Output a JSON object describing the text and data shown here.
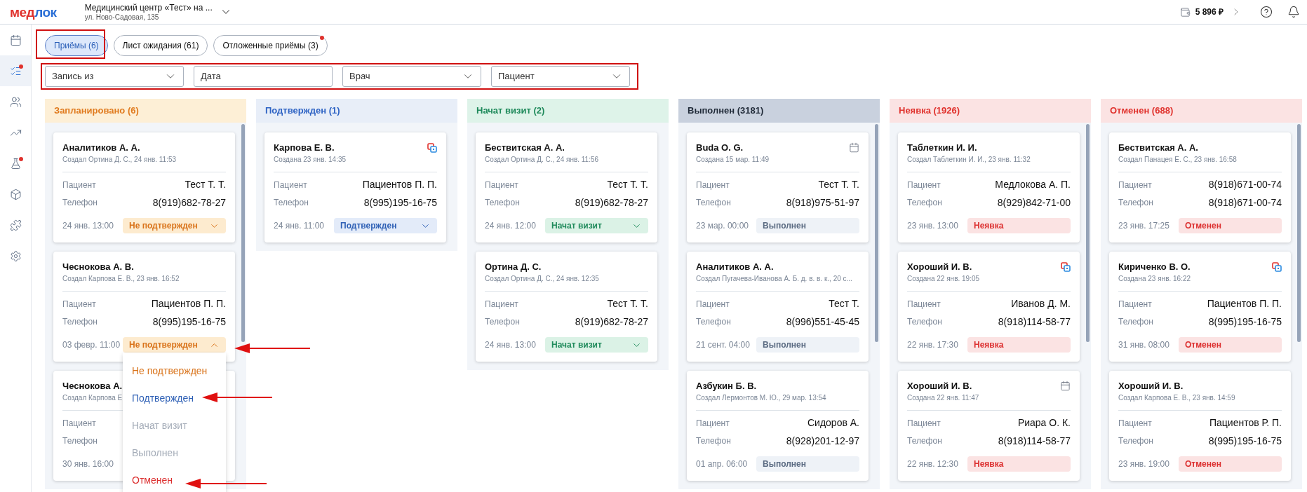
{
  "header": {
    "logo": {
      "primary": "мед",
      "secondary": "лок"
    },
    "clinic": {
      "name": "Медицинский центр «Тест» на ...",
      "address": "ул. Ново-Садовая, 135"
    },
    "balance": "5 896 ₽"
  },
  "sidebar": {
    "items": [
      {
        "selected": false,
        "badge": false
      },
      {
        "selected": true,
        "badge": true
      },
      {
        "selected": false,
        "badge": false
      },
      {
        "selected": false,
        "badge": false
      },
      {
        "selected": false,
        "badge": true
      },
      {
        "selected": false,
        "badge": false
      },
      {
        "selected": false,
        "badge": false
      },
      {
        "selected": false,
        "badge": false
      }
    ]
  },
  "tabs": [
    {
      "label": "Приёмы (6)",
      "selected": true,
      "badge": false
    },
    {
      "label": "Лист ожидания (61)",
      "selected": false,
      "badge": false
    },
    {
      "label": "Отложенные приёмы (3)",
      "selected": false,
      "badge": true
    }
  ],
  "filters": [
    {
      "kind": "select",
      "placeholder": "Запись из"
    },
    {
      "kind": "input",
      "placeholder": "Дата"
    },
    {
      "kind": "select",
      "placeholder": "Врач"
    },
    {
      "kind": "select",
      "placeholder": "Пациент"
    }
  ],
  "columns": [
    {
      "kind": "planned",
      "title": "Запланировано (6)",
      "cards": [
        {
          "name": "Аналитиков А. А.",
          "created": "Создал Ортина Д. С., 24 янв. 11:53",
          "patient_label": "Пациент",
          "patient": "Тест Т. Т.",
          "phone_label": "Телефон",
          "phone": "8(919)682-78-27",
          "date": "24 янв. 13:00",
          "status": {
            "kind": "planned",
            "label": "Не подтвержден",
            "expanded": false
          }
        },
        {
          "name": "Чеснокова А. В.",
          "created": "Создал Карпова Е. В., 23 янв. 16:52",
          "patient_label": "Пациент",
          "patient": "Пациентов П. П.",
          "phone_label": "Телефон",
          "phone": "8(995)195-16-75",
          "date": "03 февр. 11:00",
          "status": {
            "kind": "planned",
            "label": "Не подтвержден",
            "expanded": true,
            "menu": [
              {
                "kind": "planned",
                "label": "Не подтвержден",
                "disabled": false
              },
              {
                "kind": "confirmed",
                "label": "Подтвержден",
                "disabled": false
              },
              {
                "label": "Начат визит",
                "disabled": true
              },
              {
                "label": "Выполнен",
                "disabled": true
              },
              {
                "kind": "cancelled",
                "label": "Отменен",
                "disabled": false
              }
            ]
          }
        },
        {
          "name": "Чеснокова А.",
          "created": "Создал Карпова Е",
          "patient_label": "Пациент",
          "phone_label": "Телефон",
          "date": "30 янв. 16:00"
        }
      ]
    },
    {
      "kind": "confirmed",
      "title": "Подтвержден (1)",
      "cards": [
        {
          "name": "Карпова Е. В.",
          "kind": "online",
          "created": "Создана 23 янв. 14:35",
          "patient_label": "Пациент",
          "patient": "Пациентов П. П.",
          "phone_label": "Телефон",
          "phone": "8(995)195-16-75",
          "date": "24 янв. 11:00",
          "status": {
            "kind": "confirmed",
            "label": "Подтвержден",
            "expanded": false
          }
        }
      ]
    },
    {
      "kind": "started",
      "title": "Начат визит (2)",
      "cards": [
        {
          "name": "Бествитская А. А.",
          "created": "Создал Ортина Д. С., 24 янв. 11:56",
          "patient_label": "Пациент",
          "patient": "Тест Т. Т.",
          "phone_label": "Телефон",
          "phone": "8(919)682-78-27",
          "date": "24 янв. 12:00",
          "status": {
            "kind": "started",
            "label": "Начат визит",
            "expanded": false
          }
        },
        {
          "name": "Ортина Д. С.",
          "created": "Создал Ортина Д. С., 24 янв. 12:35",
          "patient_label": "Пациент",
          "patient": "Тест Т. Т.",
          "phone_label": "Телефон",
          "phone": "8(919)682-78-27",
          "date": "24 янв. 13:00",
          "status": {
            "kind": "started",
            "label": "Начат визит",
            "expanded": false
          }
        }
      ]
    },
    {
      "kind": "done",
      "title": "Выполнен (3181)",
      "cards": [
        {
          "name": "Buda O. G.",
          "kind": "calendar",
          "created": "Создана 15 мар. 11:49",
          "patient_label": "Пациент",
          "patient": "Тест Т. Т.",
          "phone_label": "Телефон",
          "phone": "8(918)975-51-97",
          "date": "23 мар. 00:00",
          "status": {
            "kind": "done",
            "label": "Выполнен"
          }
        },
        {
          "name": "Аналитиков А. А.",
          "created": "Создал Пугачева-Иванова А. Б. д. в. в. к., 20 с...",
          "patient_label": "Пациент",
          "patient": "Тест Т.",
          "phone_label": "Телефон",
          "phone": "8(996)551-45-45",
          "date": "21 сент. 04:00",
          "status": {
            "kind": "done",
            "label": "Выполнен"
          }
        },
        {
          "name": "Азбукин Б. В.",
          "created": "Создал Лермонтов М. Ю., 29 мар. 13:54",
          "patient_label": "Пациент",
          "patient": "Сидоров А.",
          "phone_label": "Телефон",
          "phone": "8(928)201-12-97",
          "date": "01 апр. 06:00",
          "status": {
            "kind": "done",
            "label": "Выполнен"
          }
        }
      ]
    },
    {
      "kind": "noshow",
      "title": "Неявка (1926)",
      "cards": [
        {
          "name": "Таблеткин И. И.",
          "created": "Создал Таблеткин И. И., 23 янв. 11:32",
          "patient_label": "Пациент",
          "patient": "Медлокова А. П.",
          "phone_label": "Телефон",
          "phone": "8(929)842-71-00",
          "date": "23 янв. 13:00",
          "status": {
            "kind": "noshow",
            "label": "Неявка"
          }
        },
        {
          "name": "Хороший И. В.",
          "kind": "online",
          "created": "Создана 22 янв. 19:05",
          "patient_label": "Пациент",
          "patient": "Иванов Д. М.",
          "phone_label": "Телефон",
          "phone": "8(918)114-58-77",
          "date": "22 янв. 17:30",
          "status": {
            "kind": "noshow",
            "label": "Неявка"
          }
        },
        {
          "name": "Хороший И. В.",
          "kind": "calendar",
          "created": "Создана 22 янв. 11:47",
          "patient_label": "Пациент",
          "patient": "Риара О. К.",
          "phone_label": "Телефон",
          "phone": "8(918)114-58-77",
          "date": "22 янв. 12:30",
          "status": {
            "kind": "noshow",
            "label": "Неявка"
          }
        }
      ]
    },
    {
      "kind": "cancelled",
      "title": "Отменен (688)",
      "cards": [
        {
          "name": "Бествитская А. А.",
          "created": "Создал Панацея Е. С., 23 янв. 16:58",
          "patient_label": "Пациент",
          "patient": "8(918)671-00-74",
          "phone_label": "Телефон",
          "phone": "8(918)671-00-74",
          "date": "23 янв. 17:25",
          "status": {
            "kind": "cancelled",
            "label": "Отменен"
          }
        },
        {
          "name": "Кириченко В. О.",
          "kind": "online",
          "created": "Создана 23 янв. 16:22",
          "patient_label": "Пациент",
          "patient": "Пациентов П. П.",
          "phone_label": "Телефон",
          "phone": "8(995)195-16-75",
          "date": "31 янв. 08:00",
          "status": {
            "kind": "cancelled",
            "label": "Отменен"
          }
        },
        {
          "name": "Хороший И. В.",
          "created": "Создал Карпова Е. В., 23 янв. 14:59",
          "patient_label": "Пациент",
          "patient": "Пациентов Р. П.",
          "phone_label": "Телефон",
          "phone": "8(995)195-16-75",
          "date": "23 янв. 19:00",
          "status": {
            "kind": "cancelled",
            "label": "Отменен"
          }
        }
      ]
    }
  ]
}
